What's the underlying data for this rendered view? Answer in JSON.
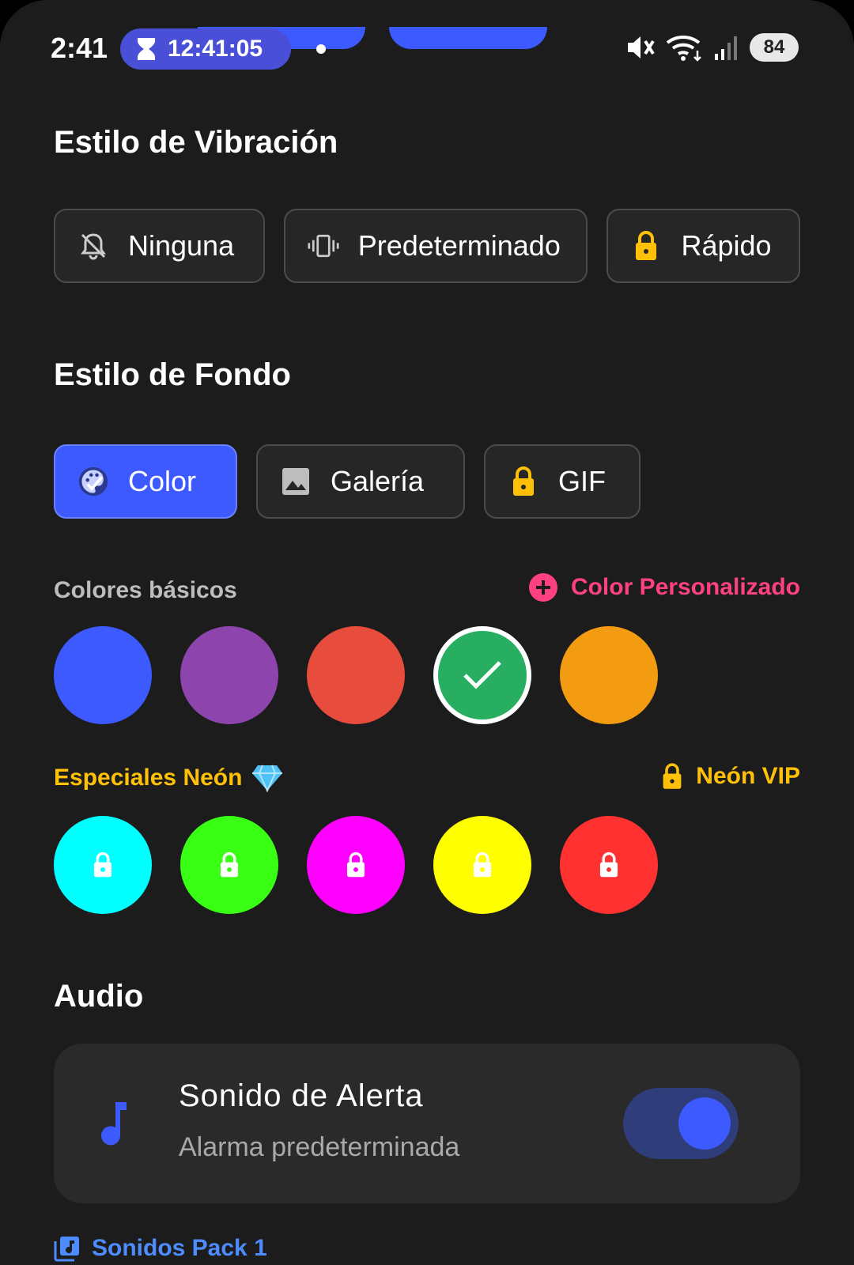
{
  "status_bar": {
    "time": "2:41",
    "timer": "12:41:05",
    "battery": "84"
  },
  "vibration": {
    "title": "Estilo de Vibración",
    "options": [
      {
        "label": "Ninguna",
        "icon": "bell-off-icon",
        "locked": false
      },
      {
        "label": "Predeterminado",
        "icon": "vibrate-icon",
        "locked": false
      },
      {
        "label": "Rápido",
        "icon": "lock-icon",
        "locked": true
      }
    ]
  },
  "background": {
    "title": "Estilo de Fondo",
    "options": [
      {
        "label": "Color",
        "icon": "palette-icon",
        "selected": true
      },
      {
        "label": "Galería",
        "icon": "image-icon",
        "selected": false
      },
      {
        "label": "GIF",
        "icon": "lock-icon",
        "locked": true
      }
    ]
  },
  "colors": {
    "basic_label": "Colores básicos",
    "custom_label": "Color Personalizado",
    "basic": [
      "#3d5afe",
      "#8e44ad",
      "#e74c3c",
      "#27ae60",
      "#f39c12"
    ],
    "selected_index": 3,
    "neon_label": "Especiales Neón",
    "neon_vip_label": "Neón VIP",
    "neon": [
      "#00ffff",
      "#39ff14",
      "#ff00ff",
      "#ffff00",
      "#ff3131"
    ]
  },
  "audio": {
    "title": "Audio",
    "alert_title": "Sonido de Alerta",
    "alert_subtitle": "Alarma predeterminada",
    "enabled": true,
    "pack_link": "Sonidos Pack 1"
  },
  "theme": {
    "accent": "#3d5afe",
    "custom_color_pink": "#ff4081",
    "gold": "#ffc107",
    "link_blue": "#4d8cff"
  }
}
